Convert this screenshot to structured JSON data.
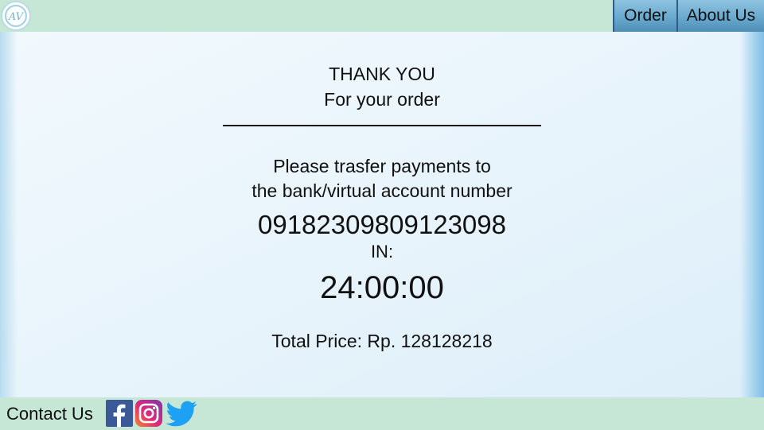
{
  "header": {
    "logo_text": "AV",
    "nav": {
      "order_label": "Order",
      "about_label": "About Us"
    }
  },
  "confirmation": {
    "thanks_title": "THANK YOU",
    "thanks_subtitle": "For your order",
    "instruction_line1": "Please trasfer payments to",
    "instruction_line2": "the bank/virtual account number",
    "account_number": "09182309809123098",
    "deadline_label": "IN:",
    "countdown": "24:00:00",
    "total_price": "Total Price: Rp. 128128218"
  },
  "footer": {
    "contact_label": "Contact Us",
    "social_icons": [
      "facebook-icon",
      "instagram-icon",
      "twitter-icon"
    ]
  },
  "colors": {
    "header_bg": "#c6e6d6",
    "nav_button": "#6aa9cf",
    "facebook": "#3b5998",
    "twitter": "#1da1f2"
  }
}
